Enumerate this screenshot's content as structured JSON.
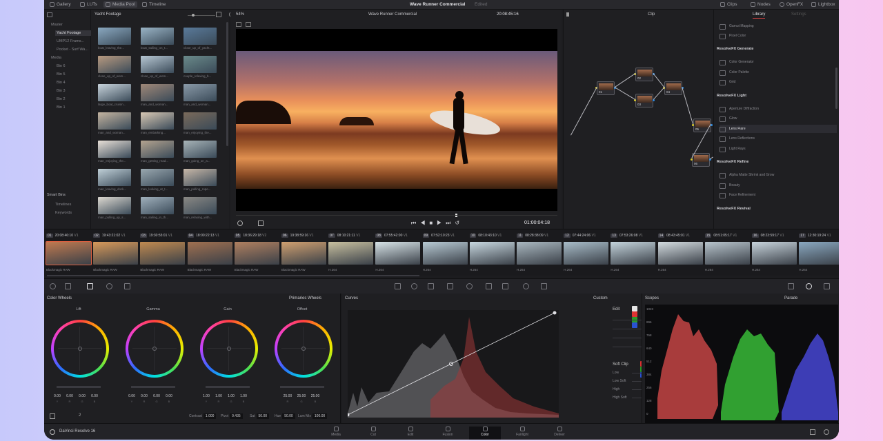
{
  "topbar": {
    "left_tabs": [
      "Gallery",
      "LUTs",
      "Media Pool",
      "Timeline"
    ],
    "project_title": "Wave Runner Commercial",
    "project_status": "Edited",
    "right_tabs": [
      "Clips",
      "Nodes",
      "OpenFX",
      "Lightbox"
    ]
  },
  "media": {
    "bin_title": "Yacht Footage",
    "tree": [
      "Master",
      "Yacht Footage",
      "UMP12 Frams...",
      "Pocket - Surf Wa...",
      "Media",
      "Bin 6",
      "Bin 5",
      "Bin 4",
      "Bin 3",
      "Bin 2",
      "Bin 1"
    ],
    "smart_bins_title": "Smart Bins",
    "smart_bins": [
      "Timelines",
      "Keywords"
    ],
    "thumbs": [
      {
        "label": "boat_leaving_the..."
      },
      {
        "label": "boat_sailing_on_t..."
      },
      {
        "label": "close_up_of_yacht..."
      },
      {
        "label": "close_up_of_wom..."
      },
      {
        "label": "close_up_of_wom..."
      },
      {
        "label": "couple_relaxing_b..."
      },
      {
        "label": "large_boat_cruisin..."
      },
      {
        "label": "man_and_woman..."
      },
      {
        "label": "man_and_woman..."
      },
      {
        "label": "man_and_woman..."
      },
      {
        "label": "man_embarking..."
      },
      {
        "label": "man_enjoying_the..."
      },
      {
        "label": "man_enjoying_the..."
      },
      {
        "label": "man_getting_read..."
      },
      {
        "label": "man_going_on_a..."
      },
      {
        "label": "man_leaving_dock..."
      },
      {
        "label": "man_looking_at_t..."
      },
      {
        "label": "man_pulling_rope..."
      },
      {
        "label": "man_pulling_up_s..."
      },
      {
        "label": "man_sailing_in_th..."
      },
      {
        "label": "man_relaxing_with..."
      }
    ]
  },
  "viewer": {
    "zoom": "54%",
    "title": "Wave Runner Commercial",
    "source_timecode": "20:08:45:16",
    "timecode": "01:00:04:18"
  },
  "nodes": {
    "mode": "Clip",
    "labels": [
      "01",
      "02",
      "03",
      "04",
      "05",
      "06"
    ]
  },
  "library": {
    "tabs": [
      "Library",
      "Settings"
    ],
    "items_top": [
      "Gamut Mapping",
      "Pixel Color"
    ],
    "sections": [
      {
        "title": "ResolveFX Generate",
        "items": [
          "Color Generator",
          "Color Palette",
          "Grid"
        ]
      },
      {
        "title": "ResolveFX Light",
        "items": [
          "Aperture Diffraction",
          "Glow",
          "Lens Flare",
          "Lens Reflections",
          "Light Rays"
        ]
      },
      {
        "title": "ResolveFX Refine",
        "items": [
          "Alpha Matte Shrink and Grow",
          "Beauty",
          "Face Refinement"
        ]
      },
      {
        "title": "ResolveFX Revival",
        "items": []
      }
    ],
    "selected": "Lens Flare"
  },
  "timeline": {
    "clips": [
      {
        "num": "01",
        "tc": "20:08:46:10",
        "track": "V1",
        "codec": "Blackmagic RAW"
      },
      {
        "num": "02",
        "tc": "19:43:21:02",
        "track": "V1",
        "codec": "Blackmagic RAW"
      },
      {
        "num": "03",
        "tc": "19:30:55:01",
        "track": "V1",
        "codec": "Blackmagic RAW"
      },
      {
        "num": "04",
        "tc": "18:00:22:13",
        "track": "V1",
        "codec": "Blackmagic RAW"
      },
      {
        "num": "05",
        "tc": "18:36:29:18",
        "track": "V2",
        "codec": "Blackmagic RAW"
      },
      {
        "num": "06",
        "tc": "19:38:59:16",
        "track": "V1",
        "codec": "Blackmagic RAW"
      },
      {
        "num": "07",
        "tc": "08:10:21:11",
        "track": "V1",
        "codec": "H.264"
      },
      {
        "num": "08",
        "tc": "07:55:42:00",
        "track": "V1",
        "codec": "H.264"
      },
      {
        "num": "09",
        "tc": "07:52:10:23",
        "track": "V1",
        "codec": "H.264"
      },
      {
        "num": "10",
        "tc": "08:10:43:10",
        "track": "V1",
        "codec": "H.264"
      },
      {
        "num": "11",
        "tc": "08:28:38:09",
        "track": "V1",
        "codec": "H.264"
      },
      {
        "num": "12",
        "tc": "07:44:24:06",
        "track": "V1",
        "codec": "H.264"
      },
      {
        "num": "13",
        "tc": "07:53:26:08",
        "track": "V1",
        "codec": "H.264"
      },
      {
        "num": "14",
        "tc": "08:43:45:01",
        "track": "V1",
        "codec": "H.264"
      },
      {
        "num": "15",
        "tc": "08:51:05:17",
        "track": "V1",
        "codec": "H.264"
      },
      {
        "num": "16",
        "tc": "08:23:59:17",
        "track": "V1",
        "codec": "H.264"
      },
      {
        "num": "17",
        "tc": "12:30:19:24",
        "track": "V1",
        "codec": "H.264"
      }
    ]
  },
  "color_wheels": {
    "title": "Color Wheels",
    "mode": "Primaries Wheels",
    "wheels": [
      {
        "name": "Lift",
        "values": [
          "0.00",
          "0.00",
          "0.00",
          "0.00"
        ],
        "keys": [
          "Y",
          "R",
          "G",
          "B"
        ]
      },
      {
        "name": "Gamma",
        "values": [
          "0.00",
          "0.00",
          "0.00",
          "0.00"
        ],
        "keys": [
          "Y",
          "R",
          "G",
          "B"
        ]
      },
      {
        "name": "Gain",
        "values": [
          "1.00",
          "1.00",
          "1.00",
          "1.00"
        ],
        "keys": [
          "Y",
          "R",
          "G",
          "B"
        ]
      },
      {
        "name": "Offset",
        "values": [
          "25.00",
          "25.00",
          "25.00"
        ],
        "keys": [
          "R",
          "G",
          "B"
        ]
      }
    ],
    "page_num": "2",
    "adjust": [
      {
        "label": "Contrast",
        "value": "1.000"
      },
      {
        "label": "Pivot",
        "value": "0.435"
      },
      {
        "label": "Sat",
        "value": "50.00"
      },
      {
        "label": "Hue",
        "value": "50.00"
      },
      {
        "label": "Lum Mix",
        "value": "100.00"
      }
    ]
  },
  "curves": {
    "title": "Curves",
    "mode": "Custom",
    "edit_label": "Edit",
    "edit_values": [
      "100",
      "100",
      "100",
      "100"
    ],
    "soft_clip_label": "Soft Clip",
    "soft_clip_rows": [
      "Low",
      "Low Soft",
      "High",
      "High Soft"
    ]
  },
  "scopes": {
    "title": "Scopes",
    "mode": "Parade",
    "ticks": [
      "1023",
      "896",
      "768",
      "640",
      "512",
      "384",
      "256",
      "128",
      "0"
    ]
  },
  "footer": {
    "app_name": "DaVinci Resolve 16",
    "pages": [
      "Media",
      "Cut",
      "Edit",
      "Fusion",
      "Color",
      "Fairlight",
      "Deliver"
    ],
    "active_page": "Color"
  }
}
